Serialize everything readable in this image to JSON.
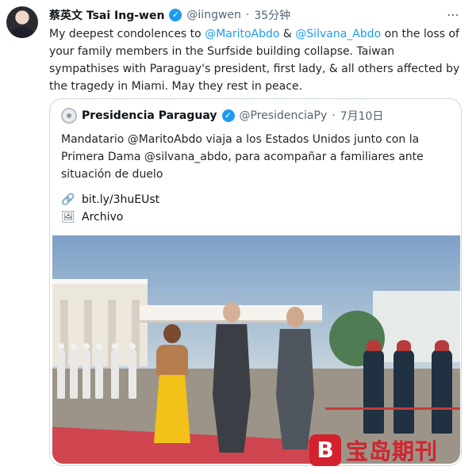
{
  "tweet": {
    "author_name": "蔡英文 Tsai Ing-wen",
    "handle": "@iingwen",
    "time": "35分钟",
    "text_parts": {
      "p1": "My deepest condolences to ",
      "m1": "@MaritoAbdo",
      "p2": " & ",
      "m2": "@Silvana_Abdo",
      "p3": " on the loss of your family members in the Surfside building collapse. Taiwan sympathises with Paraguay's president, first lady, & all others affected by the tragedy in Miami. May they rest in peace."
    }
  },
  "quote": {
    "author_name": "Presidencia Paraguay",
    "handle": "@PresidenciaPy",
    "date": "7月10日",
    "text": "Mandatario @MaritoAbdo viaja a los Estados Unidos junto con la Primera Dama @silvana_abdo, para acompañar a familiares ante situación de duelo",
    "link": "bit.ly/3huEUst",
    "archive_label": "Archivo"
  },
  "watermark": {
    "logo_letter": "B",
    "text": "宝岛期刊",
    "color": "#d3212d"
  },
  "icons": {
    "verified": "verified-check-icon",
    "menu": "more-icon",
    "link": "link-icon",
    "archive": "image-icon"
  },
  "colors": {
    "mention": "#1d9bf0",
    "muted": "#536471",
    "verified": "#1d9bf0"
  }
}
